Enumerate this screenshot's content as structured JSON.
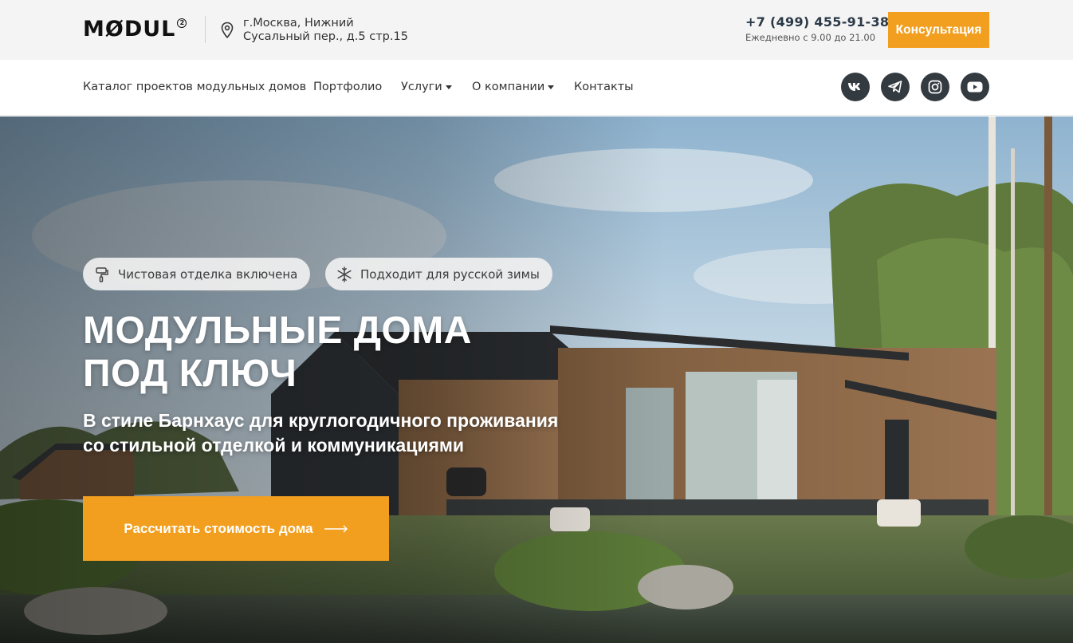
{
  "header": {
    "logo": "MØDUL",
    "logo_mark": "2",
    "address_line1": "г.Москва, Нижний",
    "address_line2": "Сусальный пер., д.5 стр.15",
    "phone": "+7 (499) 455-91-38",
    "hours": "Ежедневно с 9.00 до 21.00",
    "consult_label": "Консультация"
  },
  "nav": {
    "items": [
      {
        "label": "Каталог проектов модульных домов",
        "dropdown": false
      },
      {
        "label": "Портфолио",
        "dropdown": false
      },
      {
        "label": "Услуги",
        "dropdown": true
      },
      {
        "label": "О компании",
        "dropdown": true
      },
      {
        "label": "Контакты",
        "dropdown": false
      }
    ],
    "social": [
      "vk-icon",
      "telegram-icon",
      "instagram-icon",
      "youtube-icon"
    ]
  },
  "hero": {
    "badges": [
      {
        "label": "Чистовая отделка включена",
        "icon": "paint-roller-icon"
      },
      {
        "label": "Подходит для русской зимы",
        "icon": "snowflake-icon"
      }
    ],
    "title_line1": "МОДУЛЬНЫЕ ДОМА",
    "title_line2": "ПОД КЛЮЧ",
    "subtitle_line1": "В стиле Барнхаус для круглогодичного проживания",
    "subtitle_line2": "со стильной отделкой и коммуникациями",
    "cta_label": "Рассчитать стоимость дома"
  },
  "colors": {
    "accent": "#f29f1f",
    "social_bg": "#333a40",
    "phone": "#2b3947",
    "topbar_bg": "#f4f4f4"
  }
}
